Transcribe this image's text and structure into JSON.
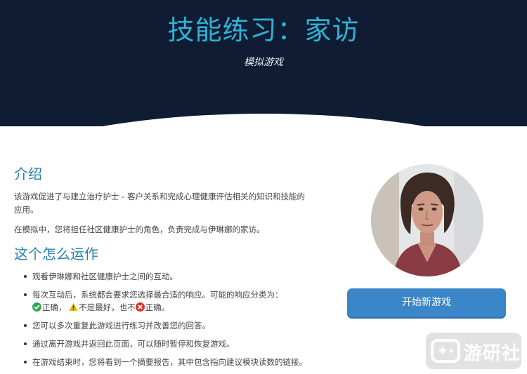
{
  "header": {
    "title": "技能练习：家访",
    "subtitle": "模拟游戏"
  },
  "intro": {
    "heading": "介绍",
    "paragraphs": [
      "该游戏促进了与建立治疗护士 - 客户关系和完成心理健康评估相关的知识和技能的应用。",
      "在模拟中，您将担任社区健康护士的角色，负责完成与伊琳娜的家访。"
    ]
  },
  "how_it_works": {
    "heading": "这个怎么运作",
    "items": [
      "观看伊琳娜和社区健康护士之间的互动。",
      "每次互动后，系统都会要求您选择最合适的响应。可能的响应分类为：",
      "您可以多次重复此游戏进行练习并改善您的回答。",
      "通过离开游戏并返回此页面，可以随时暂停和恢复游戏。",
      "在游戏结束时，您将看到一个摘要报告，其中包含指向建议模块读数的链接。"
    ],
    "categories": {
      "correct": "正确，",
      "not_best": "不是最好，",
      "also_not": "也不",
      "incorrect": "正确。"
    }
  },
  "actions": {
    "start_label": "开始新游戏"
  },
  "watermark": {
    "text": "游研社"
  },
  "colors": {
    "header_bg": "#0f1c33",
    "title": "#2eb3d4",
    "heading": "#2a7fa8",
    "button": "#3a86c8"
  }
}
